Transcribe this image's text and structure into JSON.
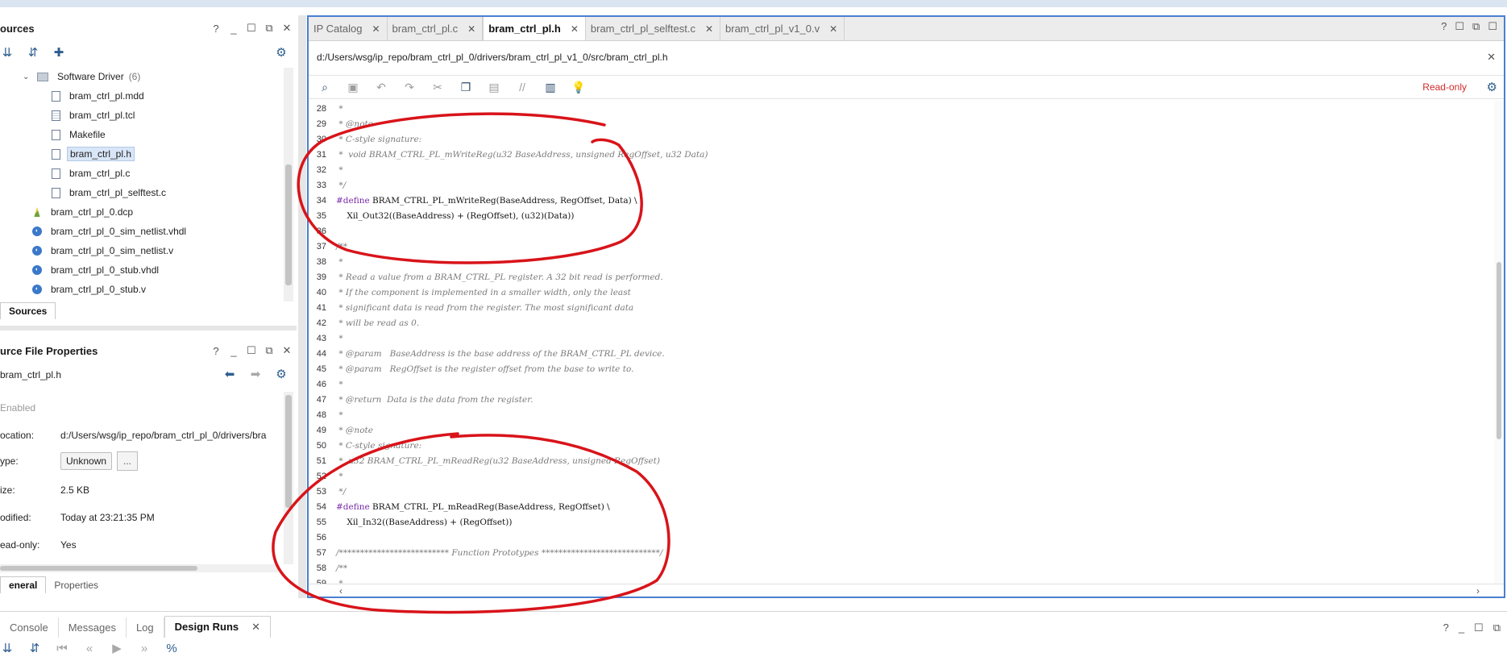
{
  "sources_panel": {
    "title": "ources",
    "tree": [
      {
        "label": "Software Driver",
        "count": "(6)"
      },
      {
        "label": "bram_ctrl_pl.mdd"
      },
      {
        "label": "bram_ctrl_pl.tcl"
      },
      {
        "label": "Makefile"
      },
      {
        "label": "bram_ctrl_pl.h"
      },
      {
        "label": "bram_ctrl_pl.c"
      },
      {
        "label": "bram_ctrl_pl_selftest.c"
      },
      {
        "label": "bram_ctrl_pl_0.dcp"
      },
      {
        "label": "bram_ctrl_pl_0_sim_netlist.vhdl"
      },
      {
        "label": "bram_ctrl_pl_0_sim_netlist.v"
      },
      {
        "label": "bram_ctrl_pl_0_stub.vhdl"
      },
      {
        "label": "bram_ctrl_pl_0_stub.v"
      }
    ],
    "bottom_tab": "Sources"
  },
  "properties_panel": {
    "title": "urce File Properties",
    "file": "bram_ctrl_pl.h",
    "enabled_label": "Enabled",
    "rows": [
      {
        "key": "ocation:",
        "value": "d:/Users/wsg/ip_repo/bram_ctrl_pl_0/drivers/bra"
      },
      {
        "key": "ype:",
        "value": "Unknown"
      },
      {
        "key": "ize:",
        "value": "2.5 KB"
      },
      {
        "key": "odified:",
        "value": "Today at 23:21:35 PM"
      },
      {
        "key": "ead-only:",
        "value": "Yes"
      }
    ],
    "more_button": "...",
    "tabs": [
      "eneral",
      "Properties"
    ]
  },
  "editor": {
    "tabs": [
      {
        "label": "IP Catalog"
      },
      {
        "label": "bram_ctrl_pl.c"
      },
      {
        "label": "bram_ctrl_pl.h"
      },
      {
        "label": "bram_ctrl_pl_selftest.c"
      },
      {
        "label": "bram_ctrl_pl_v1_0.v"
      }
    ],
    "path": "d:/Users/wsg/ip_repo/bram_ctrl_pl_0/drivers/bram_ctrl_pl_v1_0/src/bram_ctrl_pl.h",
    "readonly_label": "Read-only",
    "lines": [
      {
        "n": "28",
        "t": " *",
        "c": true
      },
      {
        "n": "29",
        "t": " * @note",
        "c": true
      },
      {
        "n": "30",
        "t": " * C-style signature:",
        "c": true
      },
      {
        "n": "31",
        "t": " *  void BRAM_CTRL_PL_mWriteReg(u32 BaseAddress, unsigned RegOffset, u32 Data)",
        "c": true
      },
      {
        "n": "32",
        "t": " *",
        "c": true
      },
      {
        "n": "33",
        "t": " */",
        "c": true
      },
      {
        "n": "34",
        "pp": "#define",
        "t": " BRAM_CTRL_PL_mWriteReg(BaseAddress, RegOffset, Data) \\",
        "c": false
      },
      {
        "n": "35",
        "t": "    Xil_Out32((BaseAddress) + (RegOffset), (u32)(Data))",
        "c": false
      },
      {
        "n": "36",
        "t": "",
        "c": false
      },
      {
        "n": "37",
        "t": "/**",
        "c": true
      },
      {
        "n": "38",
        "t": " *",
        "c": true
      },
      {
        "n": "39",
        "t": " * Read a value from a BRAM_CTRL_PL register. A 32 bit read is performed.",
        "c": true
      },
      {
        "n": "40",
        "t": " * If the component is implemented in a smaller width, only the least",
        "c": true
      },
      {
        "n": "41",
        "t": " * significant data is read from the register. The most significant data",
        "c": true
      },
      {
        "n": "42",
        "t": " * will be read as 0.",
        "c": true
      },
      {
        "n": "43",
        "t": " *",
        "c": true
      },
      {
        "n": "44",
        "t": " * @param   BaseAddress is the base address of the BRAM_CTRL_PL device.",
        "c": true
      },
      {
        "n": "45",
        "t": " * @param   RegOffset is the register offset from the base to write to.",
        "c": true
      },
      {
        "n": "46",
        "t": " *",
        "c": true
      },
      {
        "n": "47",
        "t": " * @return  Data is the data from the register.",
        "c": true
      },
      {
        "n": "48",
        "t": " *",
        "c": true
      },
      {
        "n": "49",
        "t": " * @note",
        "c": true
      },
      {
        "n": "50",
        "t": " * C-style signature:",
        "c": true
      },
      {
        "n": "51",
        "t": " *  u32 BRAM_CTRL_PL_mReadReg(u32 BaseAddress, unsigned RegOffset)",
        "c": true
      },
      {
        "n": "52",
        "t": " *",
        "c": true
      },
      {
        "n": "53",
        "t": " */",
        "c": true
      },
      {
        "n": "54",
        "pp": "#define",
        "t": " BRAM_CTRL_PL_mReadReg(BaseAddress, RegOffset) \\",
        "c": false
      },
      {
        "n": "55",
        "t": "    Xil_In32((BaseAddress) + (RegOffset))",
        "c": false
      },
      {
        "n": "56",
        "t": "",
        "c": false
      },
      {
        "n": "57",
        "t": "/************************** Function Prototypes ****************************/",
        "c": true
      },
      {
        "n": "58",
        "t": "/**",
        "c": true
      },
      {
        "n": "59",
        "t": " *",
        "c": true
      }
    ]
  },
  "bottom_panel": {
    "tabs": [
      {
        "label": "Console"
      },
      {
        "label": "Messages"
      },
      {
        "label": "Log"
      },
      {
        "label": "Design Runs"
      }
    ]
  },
  "colors": {
    "editor_border": "#4a7fd0",
    "readonly": "#d12b2b",
    "annotation": "#d8141a",
    "selection": "#d9e6f7"
  }
}
